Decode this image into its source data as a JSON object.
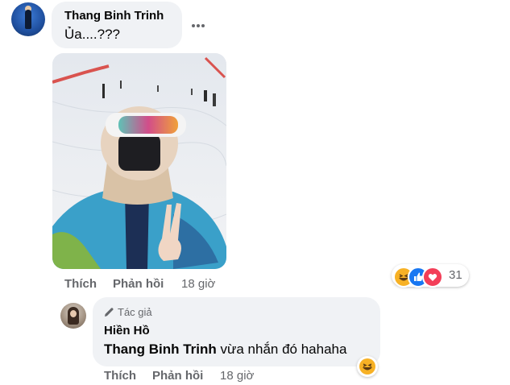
{
  "comment": {
    "author": "Thang Binh Trinh",
    "text": "Ủa....???",
    "more_icon": "more-horizontal-icon",
    "photo_icon": "photo-ski-selfie",
    "actions": {
      "like": "Thích",
      "reply": "Phản hồi",
      "time": "18 giờ"
    },
    "reactions": {
      "icons": [
        "haha",
        "like",
        "love"
      ],
      "count": "31"
    }
  },
  "reply": {
    "author_badge": "Tác giả",
    "author": "Hiền Hồ",
    "mention": "Thang Binh Trinh",
    "text": " vừa nhắn đó hahaha",
    "reaction": "haha",
    "actions": {
      "like": "Thích",
      "reply": "Phản hồi",
      "time": "18 giờ"
    }
  },
  "colors": {
    "bubble": "#f0f2f5",
    "meta": "#65676b",
    "text": "#050505",
    "like": "#1877f2",
    "love": "#f33e58",
    "haha": "#f7b125"
  }
}
